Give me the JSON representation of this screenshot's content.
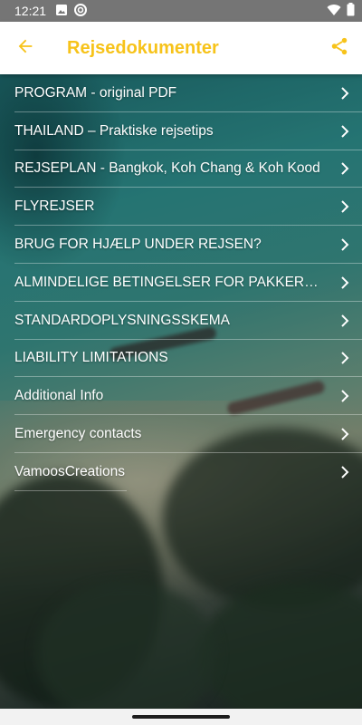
{
  "status_bar": {
    "time": "12:21",
    "left_icons": [
      "image-icon",
      "sync-icon"
    ],
    "right_icons": [
      "wifi-icon",
      "battery-icon"
    ]
  },
  "app_bar": {
    "title": "Rejsedokumenter",
    "back_icon": "arrow-left-icon",
    "share_icon": "share-icon",
    "accent_color": "#F7C31A"
  },
  "documents": [
    {
      "label": "PROGRAM - original PDF"
    },
    {
      "label": "THAILAND – Praktiske rejsetips"
    },
    {
      "label": "REJSEPLAN - Bangkok, Koh Chang & Koh Kood"
    },
    {
      "label": "FLYREJSER"
    },
    {
      "label": "BRUG FOR HJÆLP UNDER REJSEN?"
    },
    {
      "label": "ALMINDELIGE BETINGELSER FOR PAKKEREJSER"
    },
    {
      "label": "STANDARDOPLYSNINGSSKEMA"
    },
    {
      "label": "LIABILITY LIMITATIONS"
    },
    {
      "label": "Additional Info"
    },
    {
      "label": "Emergency contacts"
    },
    {
      "label": "VamoosCreations"
    }
  ]
}
